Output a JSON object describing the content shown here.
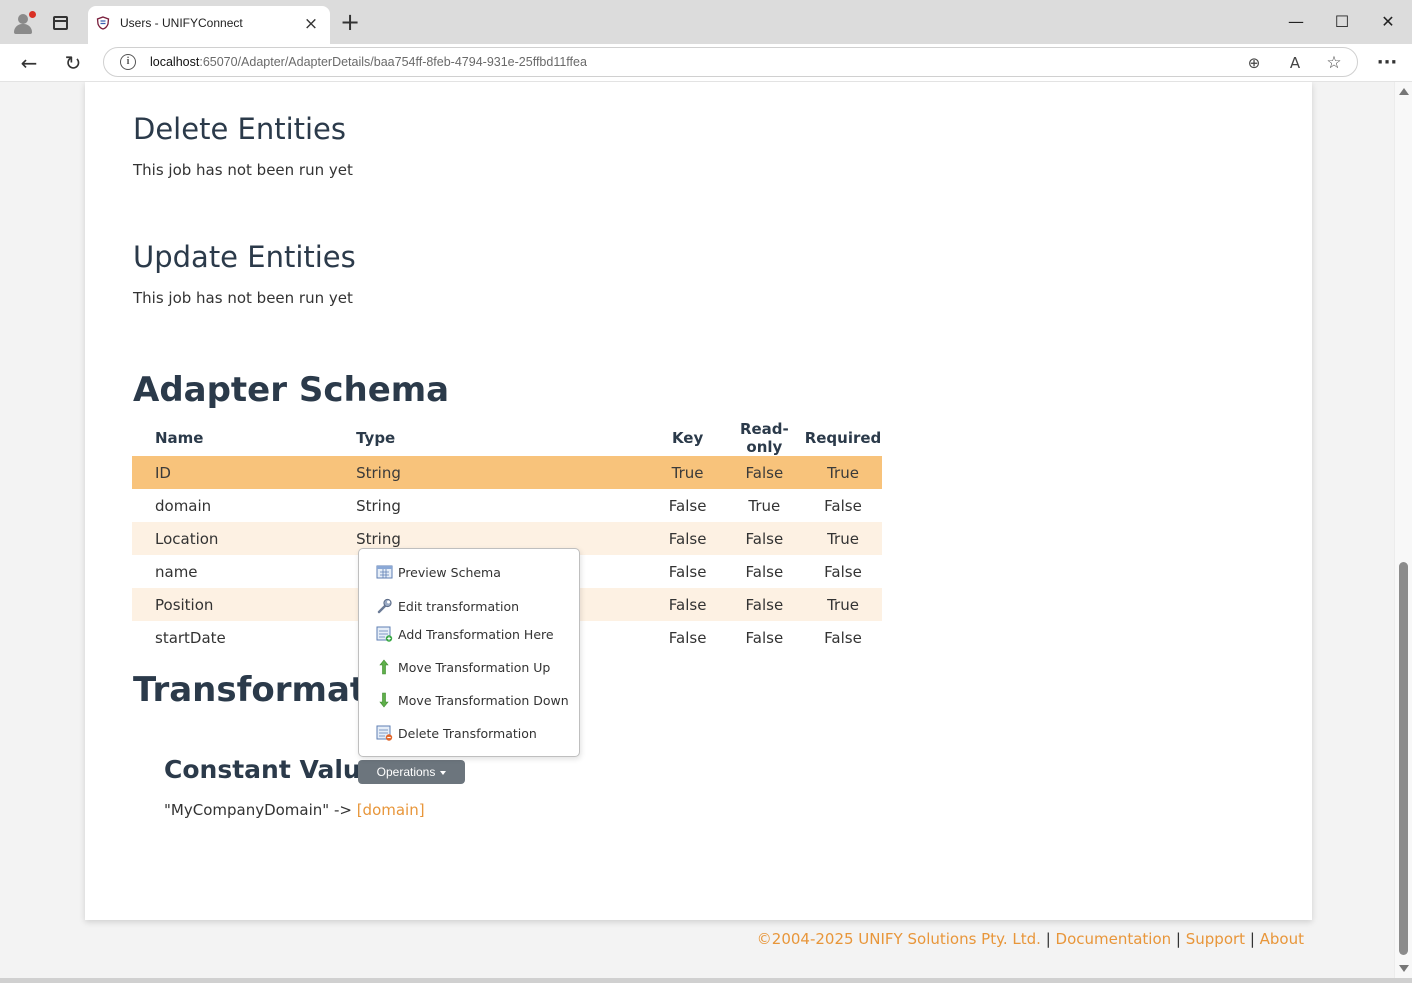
{
  "browser": {
    "tab_title": "Users - UNIFYConnect",
    "url_host": "localhost",
    "url_rest": ":65070/Adapter/AdapterDetails/baa754ff-8feb-4794-931e-25ffbd11ffea",
    "new_tab_symbol": "+",
    "tab_close_symbol": "×",
    "back_symbol": "←",
    "reload_symbol": "↻",
    "minimize_symbol": "—",
    "maximize_symbol": "☐",
    "close_symbol": "✕",
    "menu_symbol": "···",
    "info_symbol": "i",
    "zoom_symbol": "⊕",
    "read_aloud_symbol": "A",
    "favorite_symbol": "☆"
  },
  "page": {
    "delete_entities": {
      "title": "Delete Entities",
      "status": "This job has not been run yet"
    },
    "update_entities": {
      "title": "Update Entities",
      "status": "This job has not been run yet"
    },
    "schema": {
      "title": "Adapter Schema",
      "columns": [
        "Name",
        "Type",
        "Key",
        "Read-only",
        "Required"
      ],
      "rows": [
        [
          "ID",
          "String",
          "True",
          "False",
          "True"
        ],
        [
          "domain",
          "String",
          "False",
          "True",
          "False"
        ],
        [
          "Location",
          "String",
          "False",
          "False",
          "True"
        ],
        [
          "name",
          "",
          "False",
          "False",
          "False"
        ],
        [
          "Position",
          "",
          "False",
          "False",
          "True"
        ],
        [
          "startDate",
          "",
          "False",
          "False",
          "False"
        ]
      ]
    },
    "transformations": {
      "title": "Transformation",
      "item_title": "Constant Value",
      "operations_label": "Operations",
      "mapping_source": "\"MyCompanyDomain\" -> ",
      "mapping_target": "[domain]"
    }
  },
  "context_menu": {
    "items": [
      {
        "label": "Preview Schema",
        "icon": "preview-schema-icon"
      },
      {
        "label": "Edit transformation",
        "icon": "wrench-icon"
      },
      {
        "label": "Add Transformation Here",
        "icon": "add-transformation-icon"
      },
      {
        "label": "Move Transformation Up",
        "icon": "arrow-up-icon"
      },
      {
        "label": "Move Transformation Down",
        "icon": "arrow-down-icon"
      },
      {
        "label": "Delete Transformation",
        "icon": "delete-transformation-icon"
      }
    ]
  },
  "footer": {
    "copyright": "©2004-2025 UNIFY Solutions Pty. Ltd.",
    "separator": " | ",
    "documentation": "Documentation",
    "support": "Support",
    "about": "About"
  },
  "colors": {
    "accent": "#e8963a",
    "selected_row": "#f8c37b",
    "striped_row": "#fdf1e3",
    "button_gray": "#6c757d",
    "heading": "#2b3a4a"
  }
}
